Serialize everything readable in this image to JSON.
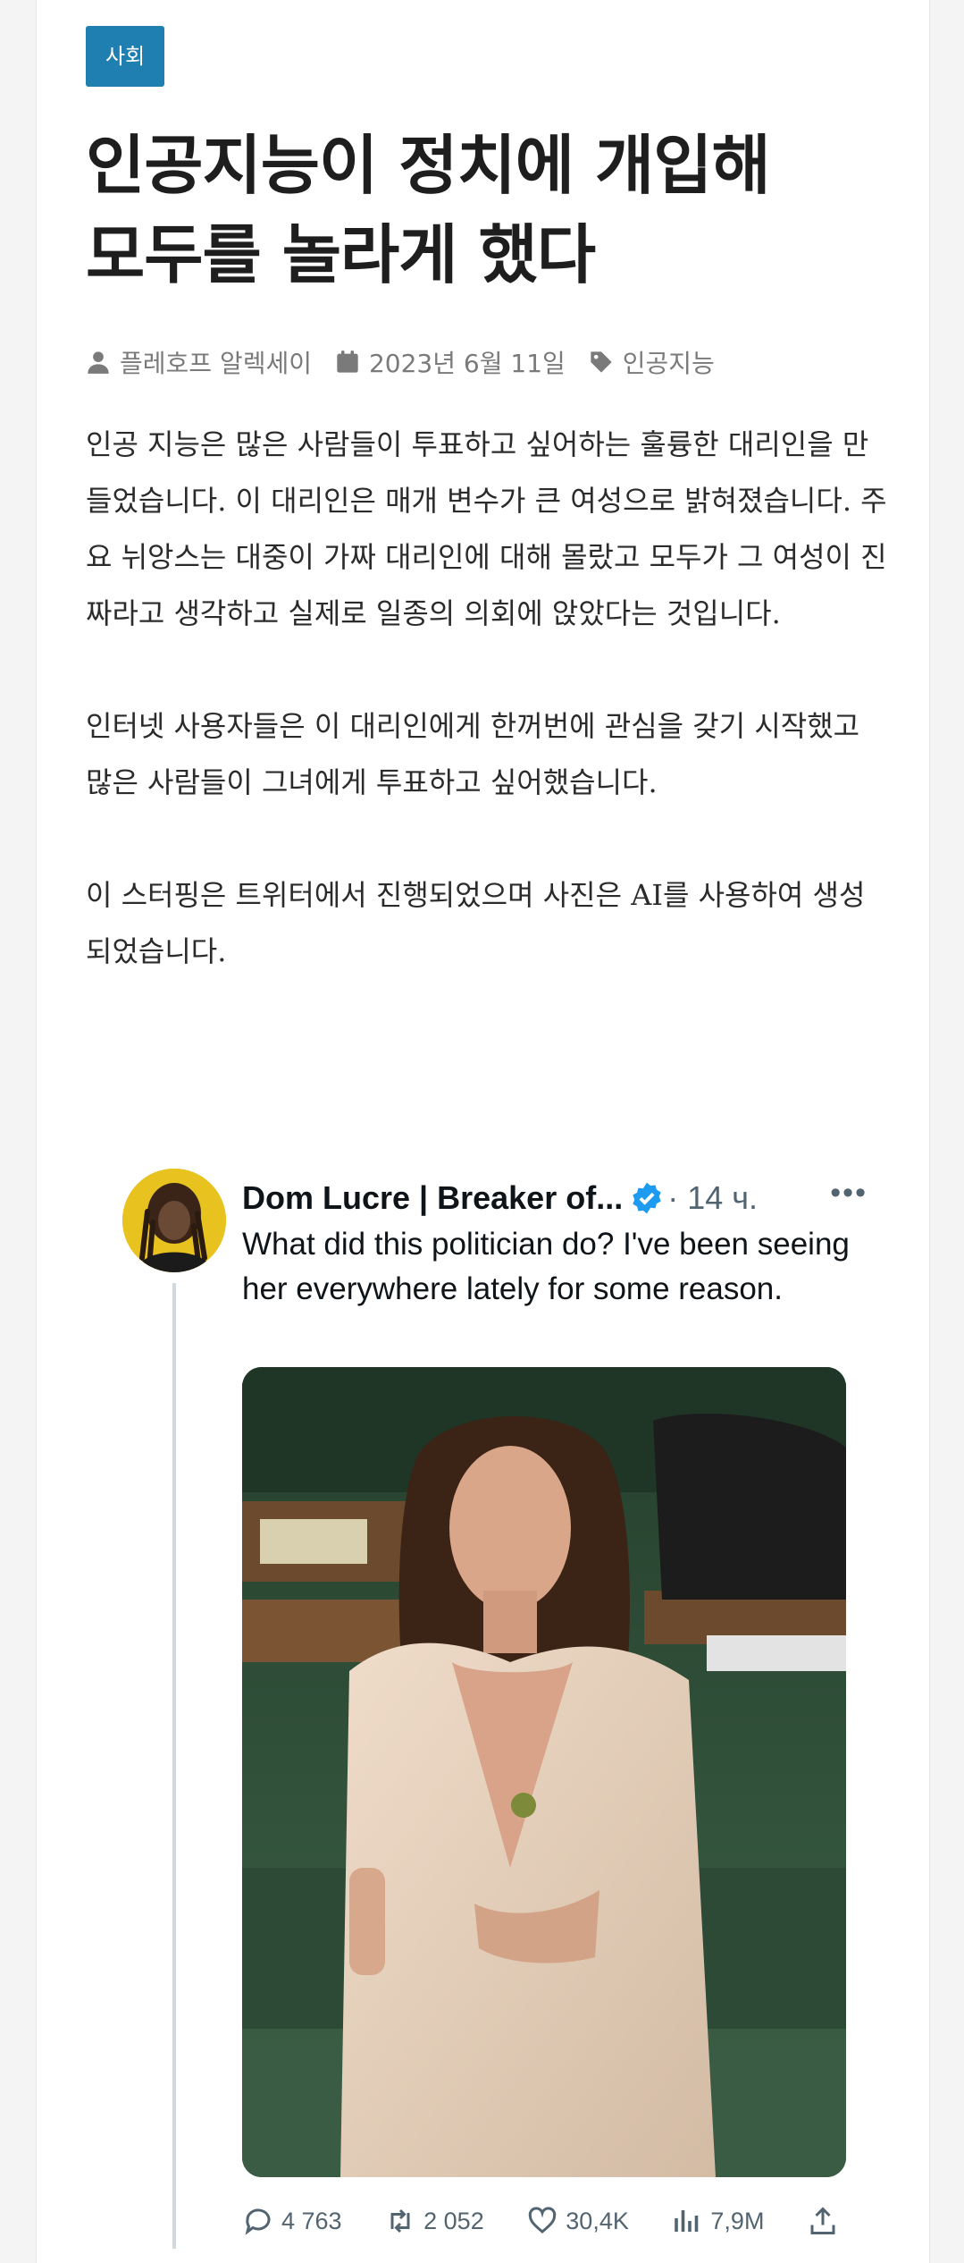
{
  "article": {
    "category": "사회",
    "title_line1": "인공지능이 정치에 개입해",
    "title_line2": "모두를 놀라게 했다",
    "meta": {
      "author": "플레호프 알렉세이",
      "date": "2023년 6월 11일",
      "tag": "인공지능"
    },
    "paragraphs": [
      "인공 지능은 많은 사람들이 투표하고 싶어하는 훌륭한 대리인을 만들었습니다. 이 대리인은 매개 변수가 큰 여성으로 밝혀졌습니다. 주요 뉘앙스는 대중이 가짜 대리인에 대해 몰랐고 모두가 그 여성이 진짜라고 생각하고 실제로 일종의 의회에 앉았다는 것입니다.",
      "인터넷 사용자들은 이 대리인에게 한꺼번에 관심을 갖기 시작했고 많은 사람들이 그녀에게 투표하고 싶어했습니다.",
      "이 스터핑은 트위터에서 진행되었으며 사진은 AI를 사용하여 생성되었습니다."
    ]
  },
  "tweet": {
    "author": "Dom Lucre | Breaker of...",
    "time": "· 14 ч.",
    "more": "•••",
    "text": "What did this politician do? I've been seeing her everywhere lately for some reason.",
    "actions": {
      "replies": "4 763",
      "retweets": "2 052",
      "likes": "30,4K",
      "views": "7,9M"
    },
    "icons": {
      "reply": "reply-icon",
      "retweet": "retweet-icon",
      "like": "heart-icon",
      "views": "views-icon",
      "share": "share-icon"
    }
  },
  "colors": {
    "category_bg": "#1f7fb0",
    "verified": "#1d9bf0",
    "meta": "#7a7a7a"
  }
}
